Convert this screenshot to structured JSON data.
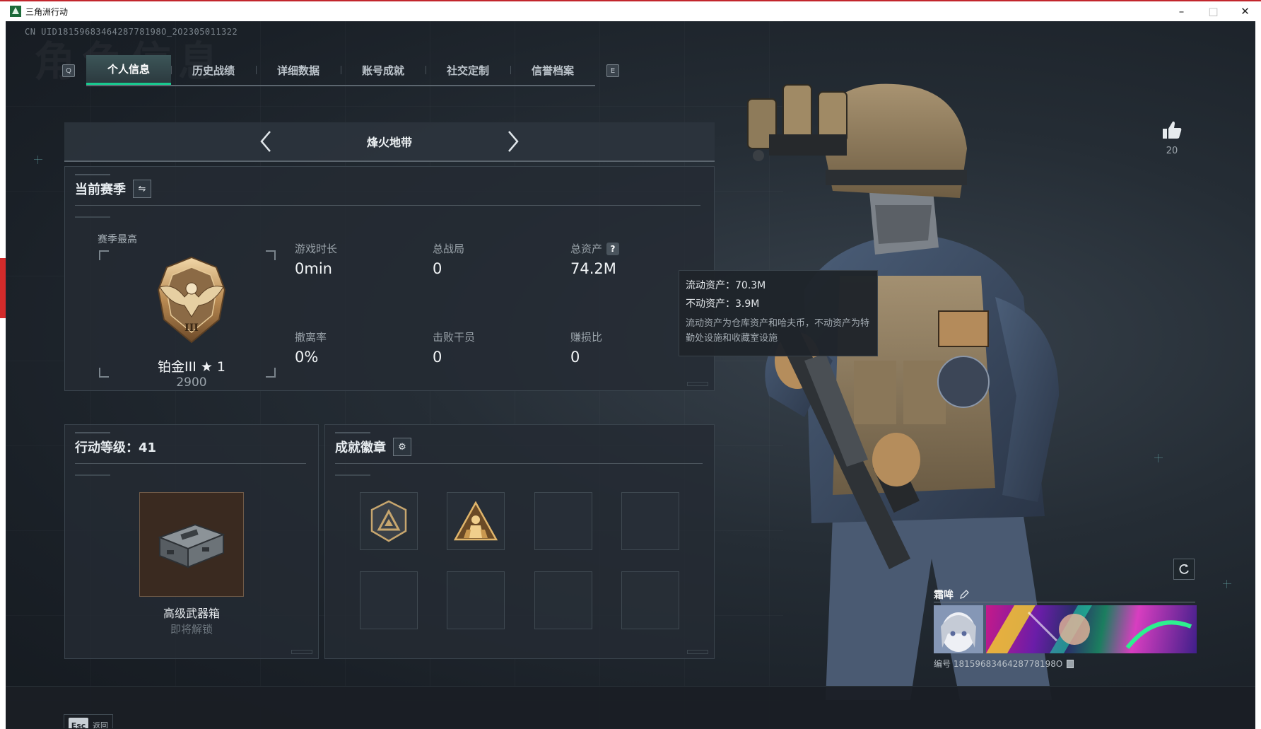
{
  "window": {
    "title": "三角洲行动",
    "minimize": "–",
    "maximize": "□",
    "close": "✕"
  },
  "uid_line": "CN UID1815968346428778198O_2O2305011322",
  "bg_watermark": "角色信息",
  "tabs": {
    "left_key": "Q",
    "right_key": "E",
    "items": [
      {
        "label": "个人信息",
        "active": true
      },
      {
        "label": "历史战绩",
        "active": false
      },
      {
        "label": "详细数据",
        "active": false
      },
      {
        "label": "账号成就",
        "active": false
      },
      {
        "label": "社交定制",
        "active": false
      },
      {
        "label": "信誉档案",
        "active": false
      }
    ]
  },
  "mode": {
    "title": "烽火地带"
  },
  "season": {
    "title": "当前赛季",
    "best_label": "赛季最高",
    "rank_name": "铂金III ★ 1",
    "rank_score": "2900",
    "stats": {
      "play_time": {
        "label": "游戏时长",
        "value": "0min"
      },
      "total_matches": {
        "label": "总战局",
        "value": "0"
      },
      "total_assets": {
        "label": "总资产",
        "value": "74.2M"
      },
      "extract_rate": {
        "label": "撤离率",
        "value": "0%"
      },
      "operators_defeated": {
        "label": "击败干员",
        "value": "0"
      },
      "profit_ratio": {
        "label": "赚损比",
        "value": "0"
      }
    }
  },
  "tooltip": {
    "liquid": "流动资产：70.3M",
    "fixed": "不动资产：3.9M",
    "note": "流动资产为仓库资产和哈夫币，不动资产为特勤处设施和收藏室设施"
  },
  "level_panel": {
    "title": "行动等级：41",
    "reward_name": "高级武器箱",
    "reward_status": "即将解锁"
  },
  "badges_panel": {
    "title": "成就徽章",
    "slots": [
      {
        "icon": "triangle-badge-icon"
      },
      {
        "icon": "soldier-badge-icon"
      },
      {
        "icon": ""
      },
      {
        "icon": ""
      },
      {
        "icon": ""
      },
      {
        "icon": ""
      },
      {
        "icon": ""
      },
      {
        "icon": ""
      }
    ]
  },
  "likes": {
    "count": "20"
  },
  "namecard": {
    "name": "霜哞",
    "id_text": "编号 1815968346428778198O"
  },
  "footer": {
    "esc_key": "Esc",
    "esc_label": "返回"
  },
  "colors": {
    "accent": "#19c98f",
    "window_accent": "#c2262d",
    "panel_bg": "#242b33"
  }
}
